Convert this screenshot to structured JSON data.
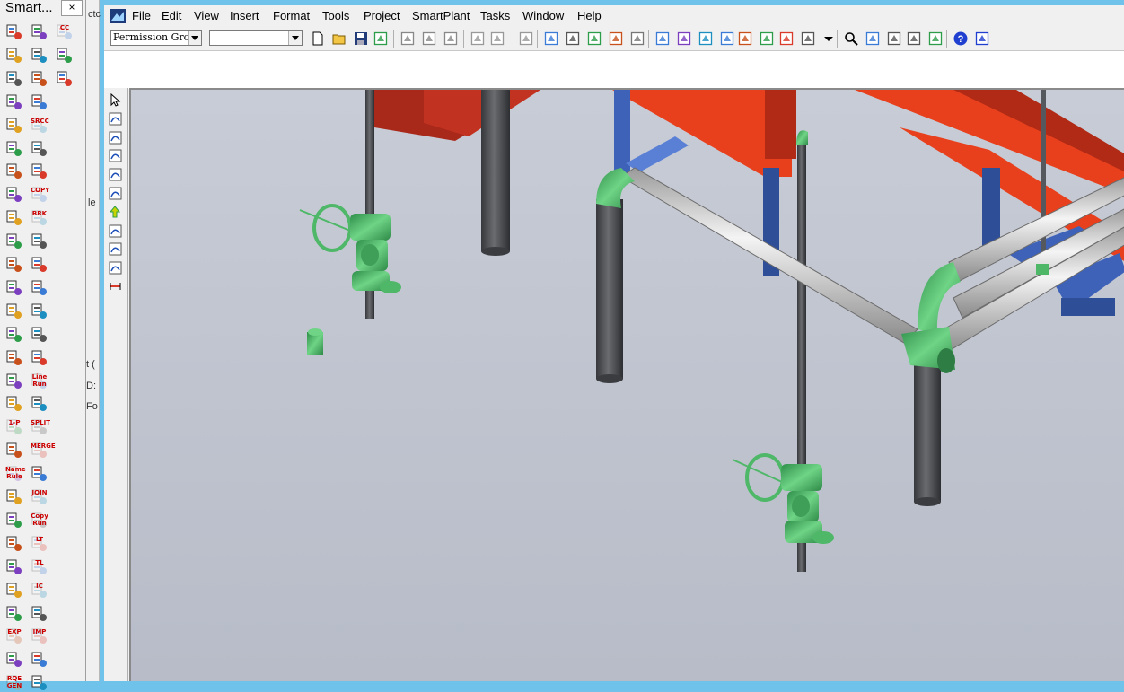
{
  "smart_panel": {
    "title": "Smart...",
    "close": "×",
    "tools": [
      {
        "name": "tool-a1",
        "text": ""
      },
      {
        "name": "tool-b1",
        "text": ""
      },
      {
        "name": "tool-c1",
        "text": "CC"
      },
      {
        "name": "tool-a2",
        "text": ""
      },
      {
        "name": "tool-b2",
        "text": ""
      },
      {
        "name": "tool-c2",
        "text": ""
      },
      {
        "name": "tool-a3",
        "text": ""
      },
      {
        "name": "tool-b3",
        "text": ""
      },
      {
        "name": "tool-c3",
        "text": ""
      },
      {
        "name": "tool-a4",
        "text": ""
      },
      {
        "name": "tool-b4",
        "text": ""
      },
      {
        "name": "tool-a5",
        "text": ""
      },
      {
        "name": "tool-b5",
        "text": "SRCC"
      },
      {
        "name": "tool-a6",
        "text": ""
      },
      {
        "name": "tool-b6",
        "text": ""
      },
      {
        "name": "tool-a7",
        "text": ""
      },
      {
        "name": "tool-b7",
        "text": ""
      },
      {
        "name": "tool-a8",
        "text": ""
      },
      {
        "name": "tool-b8",
        "text": "COPY"
      },
      {
        "name": "tool-a9",
        "text": ""
      },
      {
        "name": "tool-b9",
        "text": "BRK"
      },
      {
        "name": "tool-a10",
        "text": ""
      },
      {
        "name": "tool-b10",
        "text": ""
      },
      {
        "name": "tool-a11",
        "text": ""
      },
      {
        "name": "tool-b11",
        "text": ""
      },
      {
        "name": "tool-a12",
        "text": ""
      },
      {
        "name": "tool-b12",
        "text": ""
      },
      {
        "name": "tool-a13",
        "text": ""
      },
      {
        "name": "tool-b13",
        "text": ""
      },
      {
        "name": "tool-a14",
        "text": ""
      },
      {
        "name": "tool-b14",
        "text": ""
      },
      {
        "name": "tool-a15",
        "text": ""
      },
      {
        "name": "tool-b15",
        "text": ""
      },
      {
        "name": "tool-a16",
        "text": ""
      },
      {
        "name": "tool-b16",
        "text": "Line Run"
      },
      {
        "name": "tool-a17",
        "text": ""
      },
      {
        "name": "tool-b17",
        "text": ""
      },
      {
        "name": "tool-a18",
        "text": "1-P"
      },
      {
        "name": "tool-b18",
        "text": "SPLIT"
      },
      {
        "name": "tool-a19",
        "text": ""
      },
      {
        "name": "tool-b19",
        "text": "MERGE"
      },
      {
        "name": "tool-a20",
        "text": "Name Rule"
      },
      {
        "name": "tool-b20",
        "text": ""
      },
      {
        "name": "tool-a21",
        "text": ""
      },
      {
        "name": "tool-b21",
        "text": "JOIN"
      },
      {
        "name": "tool-a22",
        "text": ""
      },
      {
        "name": "tool-b22",
        "text": "Copy Run"
      },
      {
        "name": "tool-a23",
        "text": ""
      },
      {
        "name": "tool-b23",
        "text": "LT"
      },
      {
        "name": "tool-a24",
        "text": ""
      },
      {
        "name": "tool-b24",
        "text": "TL"
      },
      {
        "name": "tool-a25",
        "text": ""
      },
      {
        "name": "tool-b25",
        "text": "IC"
      },
      {
        "name": "tool-a26",
        "text": ""
      },
      {
        "name": "tool-b26",
        "text": ""
      },
      {
        "name": "tool-a27",
        "text": "EXP"
      },
      {
        "name": "tool-b27",
        "text": "IMP"
      },
      {
        "name": "tool-a28",
        "text": ""
      },
      {
        "name": "tool-b28",
        "text": ""
      },
      {
        "name": "tool-a29",
        "text": "RQE GEN"
      },
      {
        "name": "tool-b29",
        "text": ""
      }
    ]
  },
  "strip_letters": [
    "ctc",
    "le",
    "t (",
    "D:",
    "Fo"
  ],
  "menu": [
    "File",
    "Edit",
    "View",
    "Insert",
    "Format",
    "Tools",
    "Project",
    "SmartPlant",
    "Tasks",
    "Window",
    "Help"
  ],
  "toolbar": {
    "permission_group": "Permission Gro",
    "second_combo": ""
  },
  "colors": {
    "steel_red": "#e8401c",
    "steel_blue": "#3d62b8",
    "pipe_grey": "#d8d8d8",
    "valve_green": "#4fb868",
    "column_dark": "#4d4f53",
    "help_blue": "#1f3fd0"
  }
}
